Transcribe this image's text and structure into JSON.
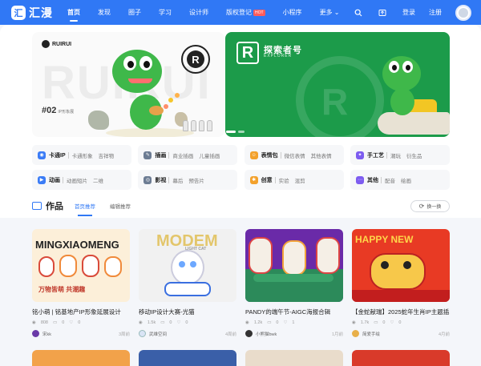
{
  "brand": {
    "logo_text": "汇漫"
  },
  "nav": {
    "items": [
      {
        "label": "首页",
        "active": true
      },
      {
        "label": "发现"
      },
      {
        "label": "圈子"
      },
      {
        "label": "学习"
      },
      {
        "label": "设计师"
      },
      {
        "label": "版权登记",
        "badge": "HOT"
      },
      {
        "label": "小程序"
      },
      {
        "label": "更多"
      }
    ],
    "login": "登录",
    "register": "注册",
    "icons": [
      "search-icon",
      "upload-icon"
    ]
  },
  "banners": {
    "left": {
      "brand": "RUIRUI",
      "ghost": "RUIRUI",
      "number": "#02",
      "number_sub": "IP形象展",
      "seal": "R"
    },
    "right": {
      "title": "探索者号",
      "subtitle": "EXPLORER",
      "logo": "R"
    }
  },
  "categories": [
    [
      {
        "name": "卡通IP",
        "icon_color": "#3b7cf6",
        "subs": [
          "卡通形象",
          "吉祥物"
        ]
      },
      {
        "name": "插画",
        "icon_color": "#6c7c93",
        "subs": [
          "商业插画",
          "儿童插画"
        ]
      },
      {
        "name": "表情包",
        "icon_color": "#f3a12b",
        "subs": [
          "微信表情",
          "其他表情"
        ]
      },
      {
        "name": "手工艺",
        "icon_color": "#7d5cf0",
        "subs": [
          "潮玩",
          "衍生品"
        ]
      }
    ],
    [
      {
        "name": "动画",
        "icon_color": "#3b7cf6",
        "subs": [
          "动画短片",
          "二维"
        ]
      },
      {
        "name": "影视",
        "icon_color": "#6c7c93",
        "subs": [
          "幕后",
          "预告片"
        ]
      },
      {
        "name": "创意",
        "icon_color": "#f3a12b",
        "subs": [
          "实验",
          "混剪"
        ]
      },
      {
        "name": "其他",
        "icon_color": "#7d5cf0",
        "subs": [
          "配音",
          "绘画"
        ]
      }
    ]
  ],
  "works": {
    "title": "作品",
    "tabs": [
      {
        "label": "首页推荐",
        "active": true
      },
      {
        "label": "编辑推荐"
      }
    ],
    "refresh_label": "换一换"
  },
  "cards": [
    {
      "title": "铭小萌 | 铭基地产IP形象延展设计",
      "views": "808",
      "comments": "0",
      "likes": "0",
      "author": "宋kk",
      "date": "3周前",
      "thumb_text": "MINGXIAOMENG",
      "thumb_sub": "万物皆萌 共潮趣"
    },
    {
      "title": "移动IP设计大赛-光猫",
      "views": "1.5k",
      "comments": "0",
      "likes": "0",
      "author": "武维空间",
      "date": "4周前",
      "thumb_text": "MODEM",
      "thumb_sub": "LIGHT CAT"
    },
    {
      "title": "PANDY的端午节-AIGC海报合辑",
      "views": "1.2k",
      "comments": "0",
      "likes": "1",
      "author": "小熊猫bwk",
      "date": "1月前",
      "thumb_text": "",
      "thumb_sub": ""
    },
    {
      "title": "【金蛇献瑞】2025蛇年生肖IP主题插...",
      "views": "1.7k",
      "comments": "0",
      "likes": "0",
      "author": "简爱手绘",
      "date": "4月前",
      "thumb_text": "HAPPY NEW",
      "thumb_sub": ""
    }
  ]
}
